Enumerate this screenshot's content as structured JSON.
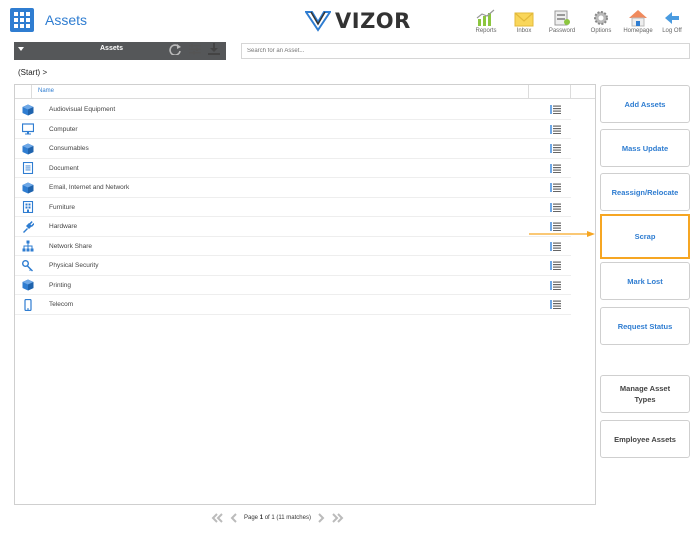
{
  "header": {
    "app_title": "Assets",
    "logo_text": "VIZOR",
    "toolbar": [
      {
        "label": "Reports",
        "icon": "reports-icon"
      },
      {
        "label": "Inbox",
        "icon": "inbox-icon"
      },
      {
        "label": "Password",
        "icon": "password-icon"
      },
      {
        "label": "Options",
        "icon": "options-icon"
      },
      {
        "label": "Homepage",
        "icon": "homepage-icon"
      },
      {
        "label": "Log Off",
        "icon": "logoff-icon"
      }
    ]
  },
  "subbar": {
    "dropdown_label": "Assets",
    "search_placeholder": "Search for an Asset..."
  },
  "breadcrumb": "(Start) >",
  "list": {
    "column_name": "Name",
    "rows": [
      {
        "label": "Audiovisual Equipment",
        "icon": "cube-icon"
      },
      {
        "label": "Computer",
        "icon": "monitor-icon"
      },
      {
        "label": "Consumables",
        "icon": "cube-icon"
      },
      {
        "label": "Document",
        "icon": "document-icon"
      },
      {
        "label": "Email, Internet and Network",
        "icon": "cube-icon"
      },
      {
        "label": "Furniture",
        "icon": "building-icon"
      },
      {
        "label": "Hardware",
        "icon": "plug-icon"
      },
      {
        "label": "Network Share",
        "icon": "network-icon"
      },
      {
        "label": "Physical Security",
        "icon": "key-icon"
      },
      {
        "label": "Printing",
        "icon": "cube-icon"
      },
      {
        "label": "Telecom",
        "icon": "phone-icon"
      }
    ]
  },
  "pager": {
    "prefix": "Page",
    "page": "1",
    "suffix": "of 1 (11 matches)"
  },
  "actions": {
    "add_assets": "Add Assets",
    "mass_update": "Mass Update",
    "reassign_relocate": "Reassign/Relocate",
    "scrap": "Scrap",
    "mark_lost": "Mark Lost",
    "request_status": "Request Status",
    "manage_asset_types": "Manage Asset Types",
    "employee_assets": "Employee Assets"
  },
  "colors": {
    "accent": "#2f7dd1",
    "highlight": "#f6a623",
    "subbar": "#555759"
  }
}
